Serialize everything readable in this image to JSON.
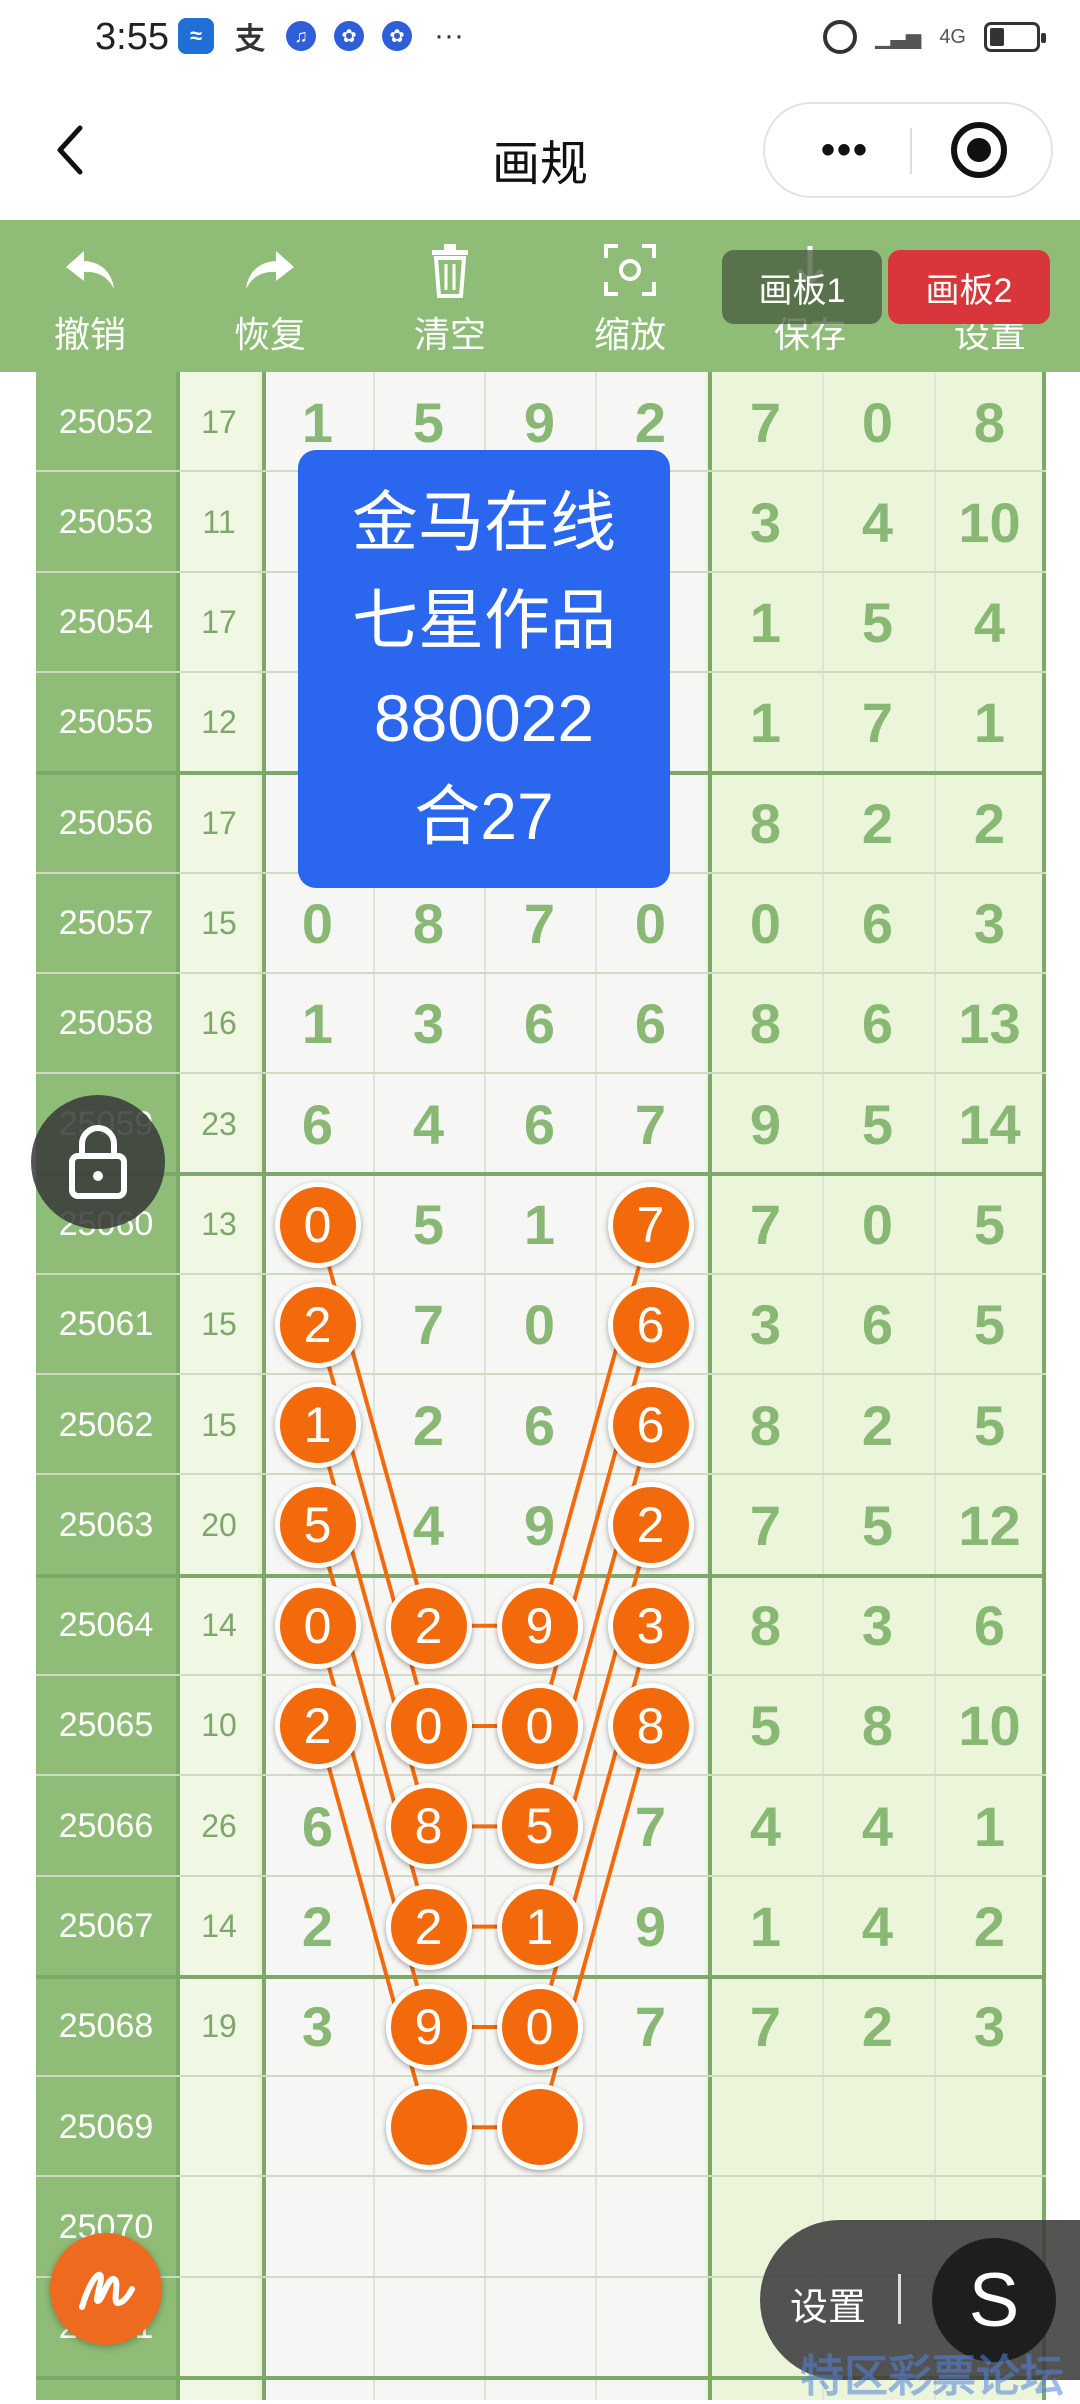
{
  "status_bar": {
    "time": "3:55",
    "network": "4G"
  },
  "header": {
    "title": "画规",
    "more_label": "•••"
  },
  "toolbar": {
    "undo": "撤销",
    "redo": "恢复",
    "clear": "清空",
    "zoom": "缩放",
    "save": "保存",
    "settings": "设置",
    "board1": "画板1",
    "board2": "画板2"
  },
  "table": {
    "rows": [
      {
        "issue": "25052",
        "sum": "17",
        "digits": [
          "1",
          "5",
          "9",
          "2",
          "7",
          "0",
          "8"
        ]
      },
      {
        "issue": "25053",
        "sum": "11",
        "digits": [
          "",
          "",
          "",
          "",
          "3",
          "4",
          "10"
        ]
      },
      {
        "issue": "25054",
        "sum": "17",
        "digits": [
          "",
          "",
          "",
          "",
          "1",
          "5",
          "4"
        ]
      },
      {
        "issue": "25055",
        "sum": "12",
        "digits": [
          "",
          "",
          "",
          "",
          "1",
          "7",
          "1"
        ]
      },
      {
        "issue": "25056",
        "sum": "17",
        "digits": [
          "",
          "",
          "",
          "",
          "8",
          "2",
          "2"
        ]
      },
      {
        "issue": "25057",
        "sum": "15",
        "digits": [
          "0",
          "8",
          "7",
          "0",
          "0",
          "6",
          "3"
        ]
      },
      {
        "issue": "25058",
        "sum": "16",
        "digits": [
          "1",
          "3",
          "6",
          "6",
          "8",
          "6",
          "13"
        ]
      },
      {
        "issue": "25059",
        "sum": "23",
        "digits": [
          "6",
          "4",
          "6",
          "7",
          "9",
          "5",
          "14"
        ]
      },
      {
        "issue": "25060",
        "sum": "13",
        "digits": [
          "0",
          "5",
          "1",
          "7",
          "7",
          "0",
          "5"
        ]
      },
      {
        "issue": "25061",
        "sum": "15",
        "digits": [
          "2",
          "7",
          "0",
          "6",
          "3",
          "6",
          "5"
        ]
      },
      {
        "issue": "25062",
        "sum": "15",
        "digits": [
          "1",
          "2",
          "6",
          "6",
          "8",
          "2",
          "5"
        ]
      },
      {
        "issue": "25063",
        "sum": "20",
        "digits": [
          "5",
          "4",
          "9",
          "2",
          "7",
          "5",
          "12"
        ]
      },
      {
        "issue": "25064",
        "sum": "14",
        "digits": [
          "0",
          "2",
          "9",
          "3",
          "8",
          "3",
          "6"
        ]
      },
      {
        "issue": "25065",
        "sum": "10",
        "digits": [
          "2",
          "0",
          "0",
          "8",
          "5",
          "8",
          "10"
        ]
      },
      {
        "issue": "25066",
        "sum": "26",
        "digits": [
          "6",
          "8",
          "5",
          "7",
          "4",
          "4",
          "1"
        ]
      },
      {
        "issue": "25067",
        "sum": "14",
        "digits": [
          "2",
          "2",
          "1",
          "9",
          "1",
          "4",
          "2"
        ]
      },
      {
        "issue": "25068",
        "sum": "19",
        "digits": [
          "3",
          "9",
          "0",
          "7",
          "7",
          "2",
          "3"
        ]
      },
      {
        "issue": "25069",
        "sum": "",
        "digits": [
          "",
          "",
          "",
          "",
          "",
          "",
          ""
        ]
      },
      {
        "issue": "25070",
        "sum": "",
        "digits": [
          "",
          "",
          "",
          "",
          "",
          "",
          ""
        ]
      },
      {
        "issue": "25071",
        "sum": "",
        "digits": [
          "",
          "",
          "",
          "",
          "",
          "",
          ""
        ]
      }
    ]
  },
  "banner": {
    "line1": "金马在线",
    "line2": "七星作品",
    "line3": "880022",
    "line4": "合27"
  },
  "floating": {
    "settings_label": "设置",
    "s_button": "S"
  },
  "watermark": "特区彩票论坛",
  "colors": {
    "toolbar_green": "#8fbd77",
    "ball_orange": "#f36a0d",
    "banner_blue": "#2a66ee",
    "board2_red": "#d9363b"
  }
}
